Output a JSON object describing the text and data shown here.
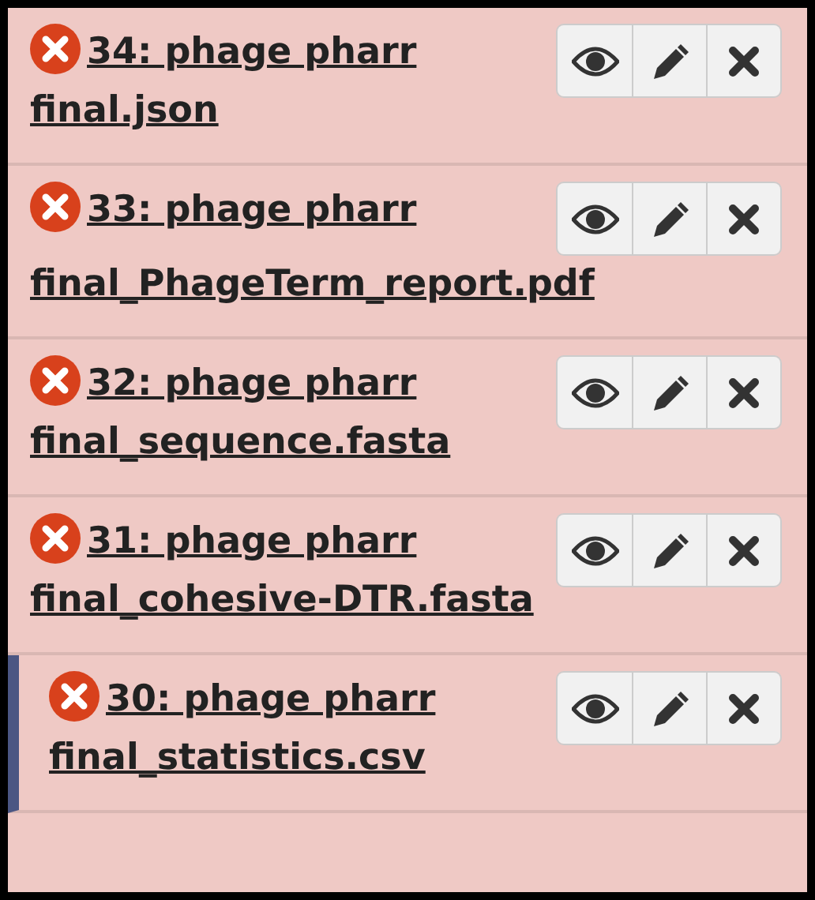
{
  "datasets": [
    {
      "title": "34: phage pharr final.json",
      "selected": false
    },
    {
      "title": "33: phage pharr final_PhageTerm_report.pdf",
      "selected": false
    },
    {
      "title": "32: phage pharr final_sequence.fasta",
      "selected": false
    },
    {
      "title": "31: phage pharr final_cohesive-DTR.fasta",
      "selected": false
    },
    {
      "title": "30: phage pharr final_statistics.csv",
      "selected": true
    }
  ]
}
